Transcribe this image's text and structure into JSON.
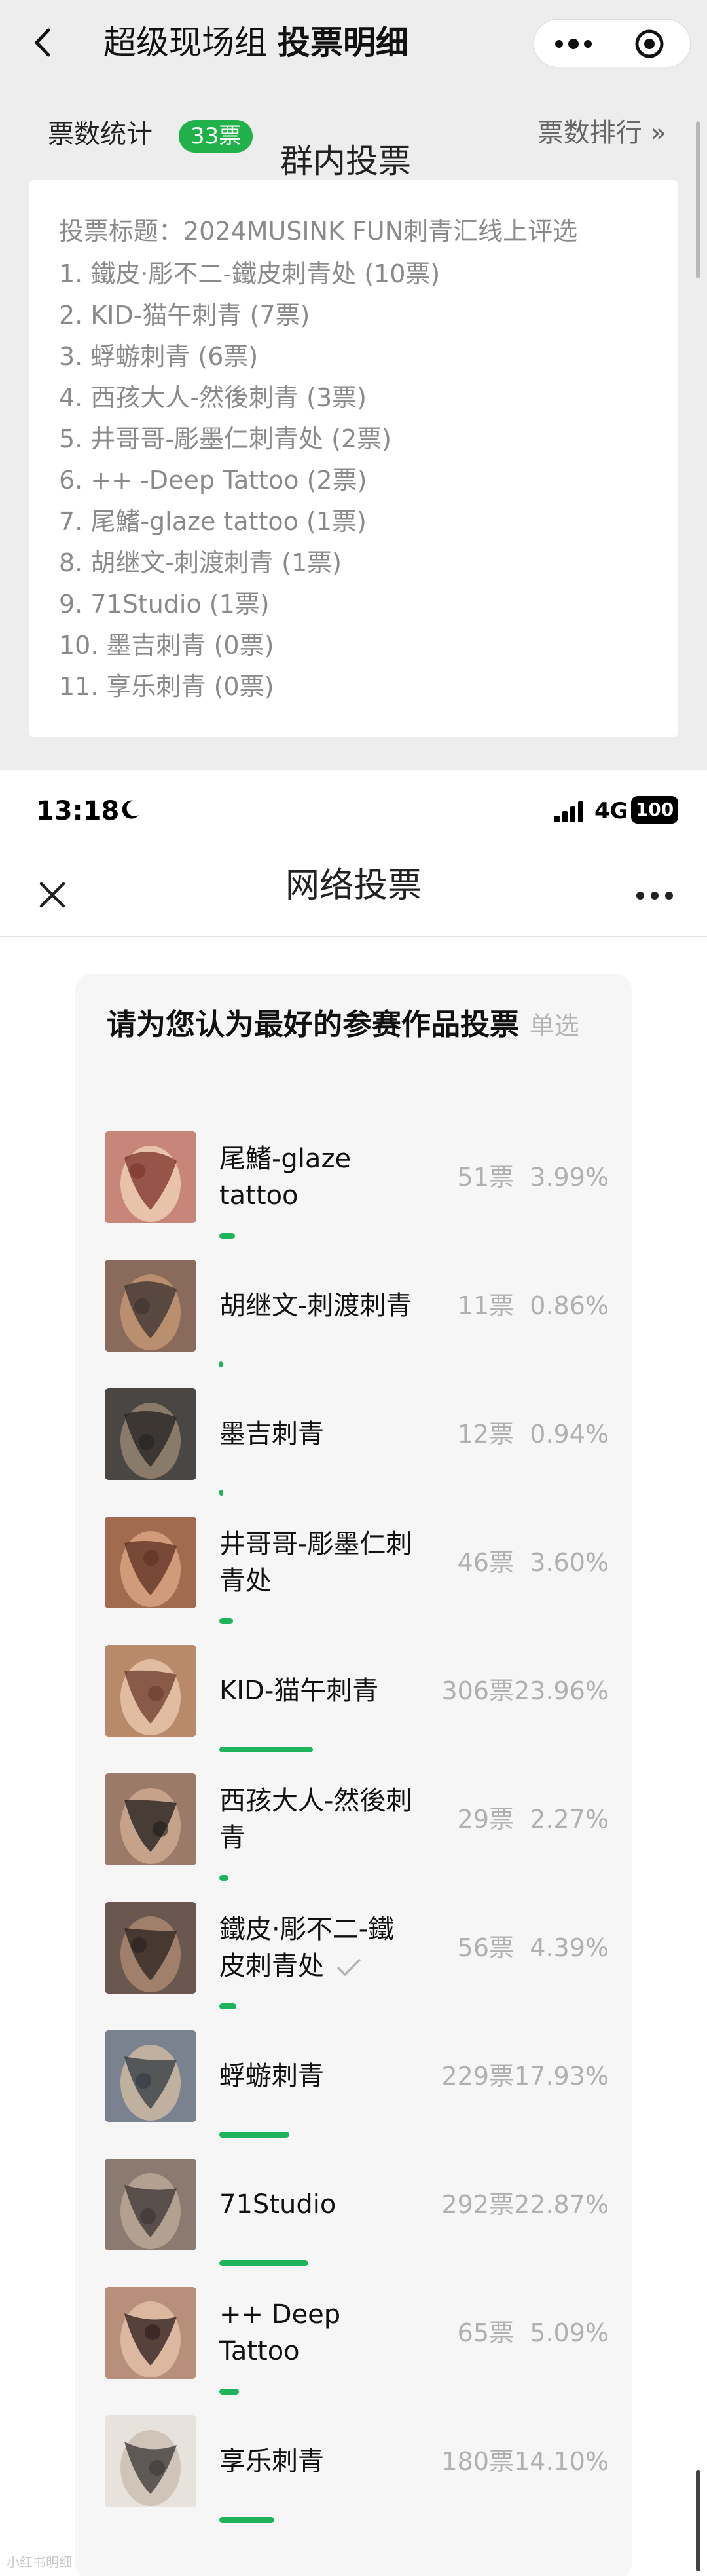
{
  "top": {
    "nav_title_prefix": "超级现场组 ",
    "nav_title_bold": "投票明细",
    "stats_label": "票数统计",
    "stats_total": "33票",
    "group_vote_label": "群内投票",
    "ranking_link": "票数排行 »",
    "poll_title": "投票标题：2024MUSINK FUN刺青汇线上评选",
    "results": [
      "1. 鐵皮·彫不二-鐵皮刺青处 (10票)",
      "2. KID-猫午刺青 (7票)",
      "3. 蜉蝣刺青 (6票)",
      "4. 西孩大人-然後刺青 (3票)",
      "5. 井哥哥-彫墨仁刺青处 (2票)",
      "6. ++ -Deep Tattoo (2票)",
      "7. 尾鰭-glaze tattoo (1票)",
      "8. 胡继文-刺渡刺青 (1票)",
      "9. 71Studio (1票)",
      "10. 墨吉刺青 (0票)",
      "11. 享乐刺青 (0票)"
    ]
  },
  "status_bar": {
    "time": "13:18",
    "network": "4G",
    "battery": "100"
  },
  "vote_page": {
    "title": "网络投票",
    "question": "请为您认为最好的参赛作品投票",
    "question_type": "单选",
    "accent_color": "#1fb35c",
    "options": [
      {
        "name": "尾鰭-glaze tattoo",
        "votes": "51票",
        "percent": "3.99%",
        "share": 0.0399,
        "selected": false
      },
      {
        "name": "胡继文-刺渡刺青",
        "votes": "11票",
        "percent": "0.86%",
        "share": 0.0086,
        "selected": false
      },
      {
        "name": "墨吉刺青",
        "votes": "12票",
        "percent": "0.94%",
        "share": 0.0094,
        "selected": false
      },
      {
        "name": "井哥哥-彫墨仁刺青处",
        "votes": "46票",
        "percent": "3.60%",
        "share": 0.036,
        "selected": false
      },
      {
        "name": "KID-猫午刺青",
        "votes": "306票",
        "percent": "23.96%",
        "share": 0.2396,
        "selected": false
      },
      {
        "name": "西孩大人-然後刺青",
        "votes": "29票",
        "percent": "2.27%",
        "share": 0.0227,
        "selected": false
      },
      {
        "name": "鐵皮·彫不二-鐵皮刺青处",
        "votes": "56票",
        "percent": "4.39%",
        "share": 0.0439,
        "selected": true
      },
      {
        "name": "蜉蝣刺青",
        "votes": "229票",
        "percent": "17.93%",
        "share": 0.1793,
        "selected": false
      },
      {
        "name": "71Studio",
        "votes": "292票",
        "percent": "22.87%",
        "share": 0.2287,
        "selected": false
      },
      {
        "name": "++ Deep Tattoo",
        "votes": "65票",
        "percent": "5.09%",
        "share": 0.0509,
        "selected": false
      },
      {
        "name": "享乐刺青",
        "votes": "180票",
        "percent": "14.10%",
        "share": 0.141,
        "selected": false
      }
    ]
  },
  "watermark": "小红书明细"
}
